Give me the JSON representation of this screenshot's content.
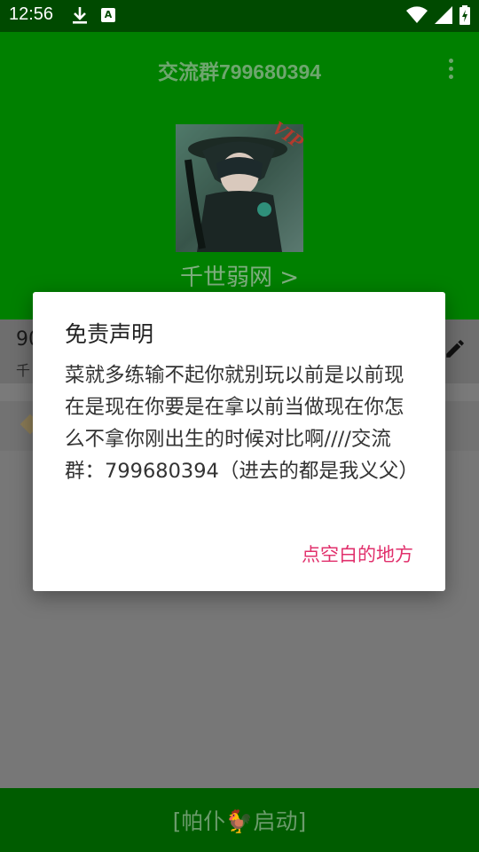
{
  "status_bar": {
    "time": "12:56"
  },
  "app_bar": {
    "title": "交流群799680394",
    "vip_badge": "VIP",
    "username": "千世弱网 >"
  },
  "list": {
    "row1_number": "90",
    "row1_sub": "千"
  },
  "bottom_bar": {
    "label": "[帕仆🐓启动]"
  },
  "dialog": {
    "title": "免责声明",
    "body": "菜就多练输不起你就别玩以前是以前现在是现在你要是在拿以前当做现在你怎么不拿你刚出生的时候对比啊////交流群：799680394（进去的都是我义父）",
    "button": "点空白的地方"
  },
  "colors": {
    "app_green": "#008000",
    "accent_pink": "#e1306c"
  },
  "icons": [
    "download-icon",
    "a-icon",
    "wifi-icon",
    "signal-icon",
    "battery-icon",
    "more-vert-icon",
    "edit-icon"
  ]
}
